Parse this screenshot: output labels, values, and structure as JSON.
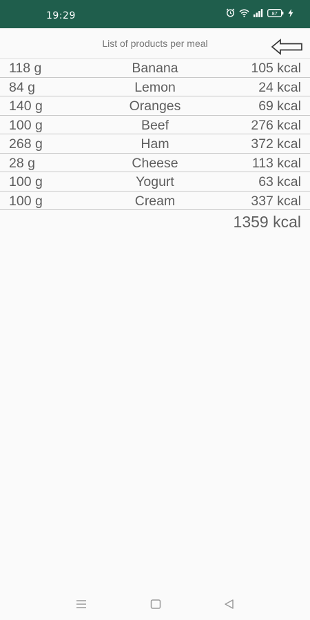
{
  "status_bar": {
    "time": "19:29",
    "battery_level": "87",
    "icons": [
      "alarm-icon",
      "wifi-icon",
      "signal-icon",
      "battery-icon",
      "charging-icon"
    ]
  },
  "header": {
    "title": "List of products per meal",
    "back_icon": "back-arrow-icon"
  },
  "products": [
    {
      "weight": "118 g",
      "name": "Banana",
      "kcal": "105 kcal"
    },
    {
      "weight": "84 g",
      "name": "Lemon",
      "kcal": "24 kcal"
    },
    {
      "weight": "140 g",
      "name": "Oranges",
      "kcal": "69 kcal"
    },
    {
      "weight": "100 g",
      "name": "Beef",
      "kcal": "276 kcal"
    },
    {
      "weight": "268 g",
      "name": "Ham",
      "kcal": "372 kcal"
    },
    {
      "weight": "28 g",
      "name": "Cheese",
      "kcal": "113 kcal"
    },
    {
      "weight": "100 g",
      "name": "Yogurt",
      "kcal": "63 kcal"
    },
    {
      "weight": "100 g",
      "name": "Cream",
      "kcal": "337 kcal"
    }
  ],
  "total": "1359 kcal",
  "navigation": {
    "icons": [
      "menu-icon",
      "home-icon",
      "back-icon"
    ]
  },
  "colors": {
    "status_bar": "#1f5e4c",
    "background": "#fafafa",
    "text": "#5e5e5e",
    "divider": "#c8c8c8"
  }
}
